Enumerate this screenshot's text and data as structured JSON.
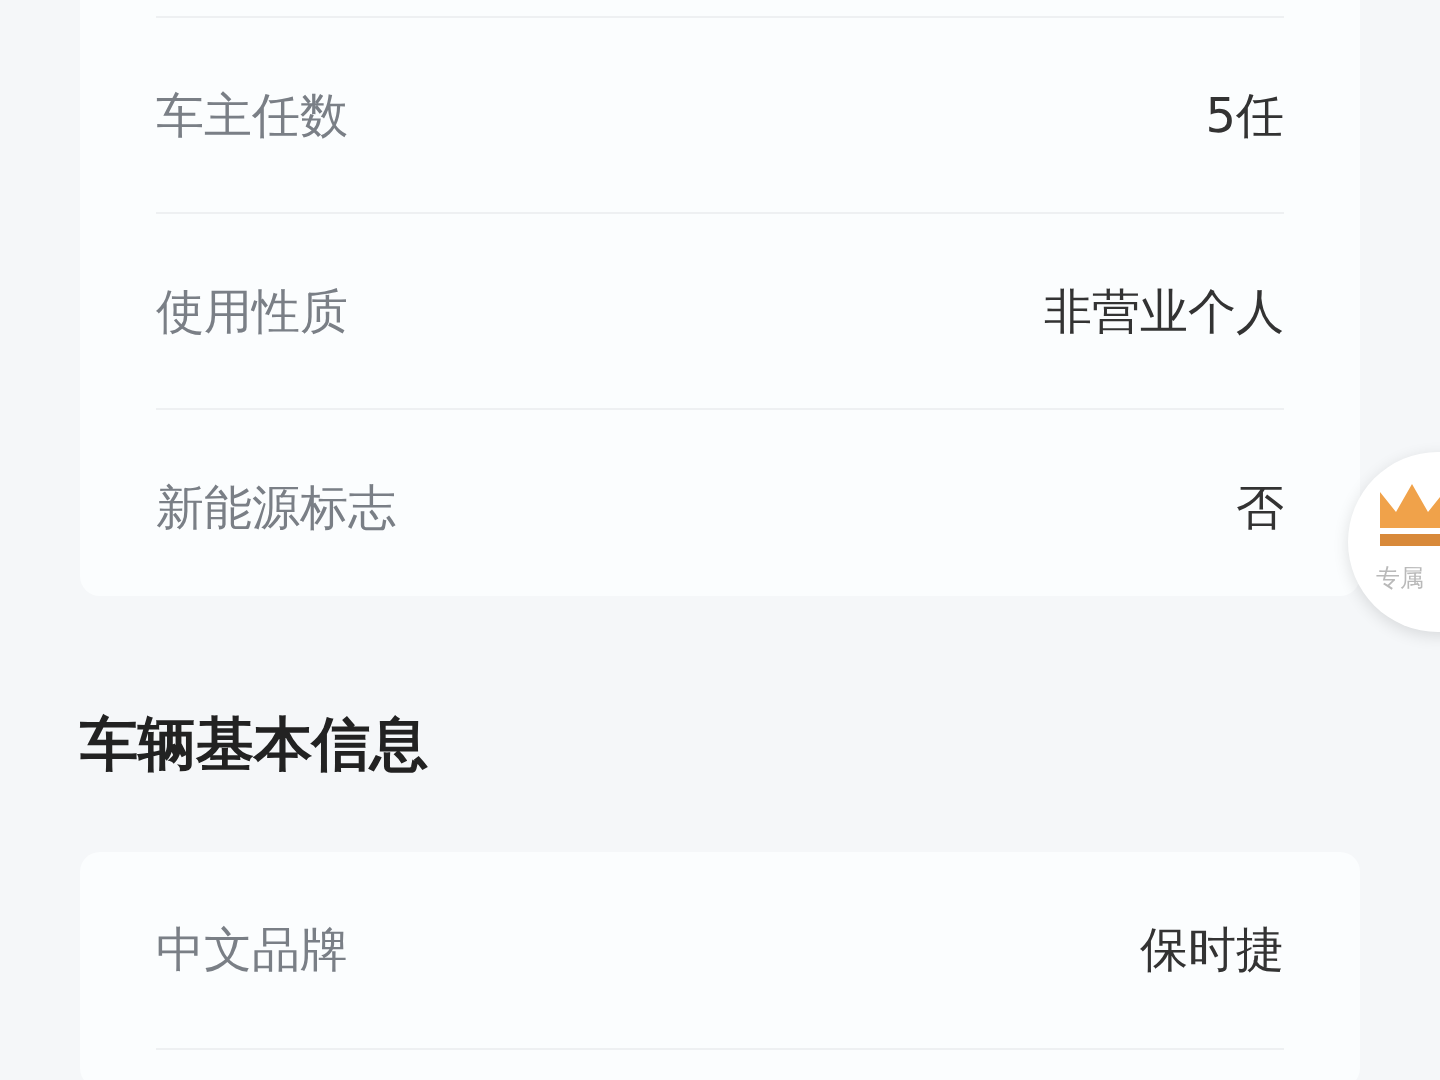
{
  "sections": [
    {
      "rows": [
        {
          "label": "车主任数",
          "value": "5任"
        },
        {
          "label": "使用性质",
          "value": "非营业个人"
        },
        {
          "label": "新能源标志",
          "value": "否"
        }
      ]
    },
    {
      "title": "车辆基本信息",
      "rows": [
        {
          "label": "中文品牌",
          "value": "保时捷"
        }
      ]
    }
  ],
  "floating_badge": {
    "label": "专属"
  }
}
